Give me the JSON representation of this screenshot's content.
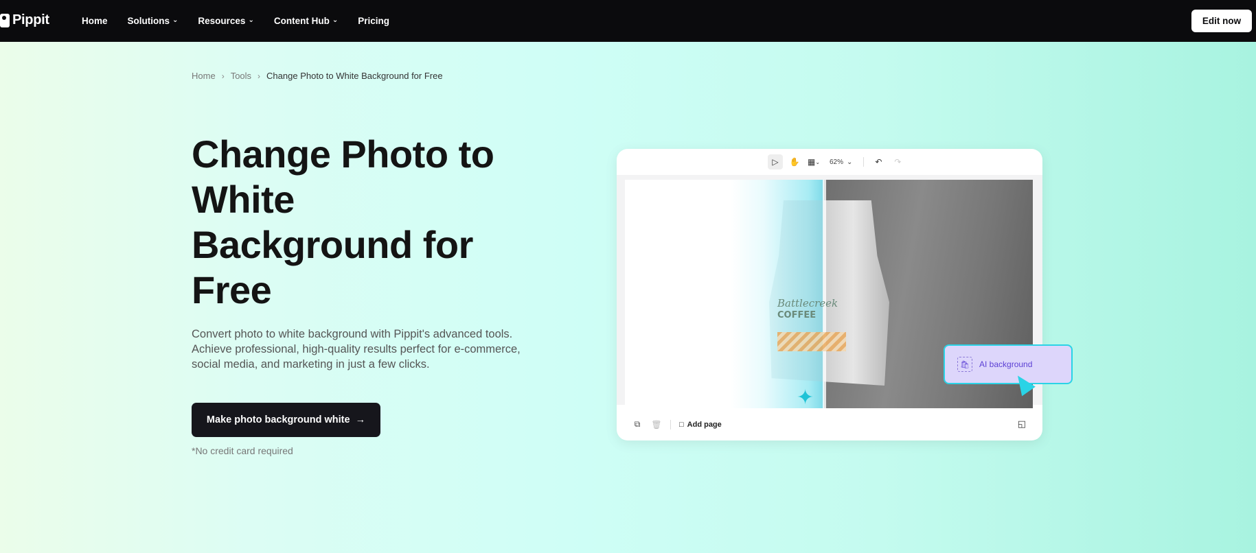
{
  "nav": {
    "logo": "Pippit",
    "items": [
      {
        "label": "Home",
        "dropdown": false
      },
      {
        "label": "Solutions",
        "dropdown": true
      },
      {
        "label": "Resources",
        "dropdown": true
      },
      {
        "label": "Content Hub",
        "dropdown": true
      },
      {
        "label": "Pricing",
        "dropdown": false
      }
    ],
    "cta": "Edit now"
  },
  "breadcrumb": {
    "home": "Home",
    "tools": "Tools",
    "current": "Change Photo to White Background for Free"
  },
  "hero": {
    "title_l1": "Change Photo to",
    "title_l2": "White",
    "title_l3": "Background for",
    "title_l4": "Free",
    "description": "Convert photo to white background with Pippit's advanced tools. Achieve professional, high-quality results perfect for e-commerce, social media, and marketing in just a few clicks.",
    "cta": "Make photo background white",
    "note": "*No credit card required"
  },
  "editor": {
    "zoom": "62%",
    "add_page": "Add page",
    "product_label_script": "Battlecreek",
    "product_label_bold": "COFFEE",
    "ai_chip": "AI background"
  },
  "colors": {
    "nav_bg": "#0b0b0d",
    "cta_bg": "#16161c",
    "accent_cyan": "#2ad3e6",
    "chip_bg": "#ddd6fb",
    "chip_text": "#5b3fd4"
  }
}
